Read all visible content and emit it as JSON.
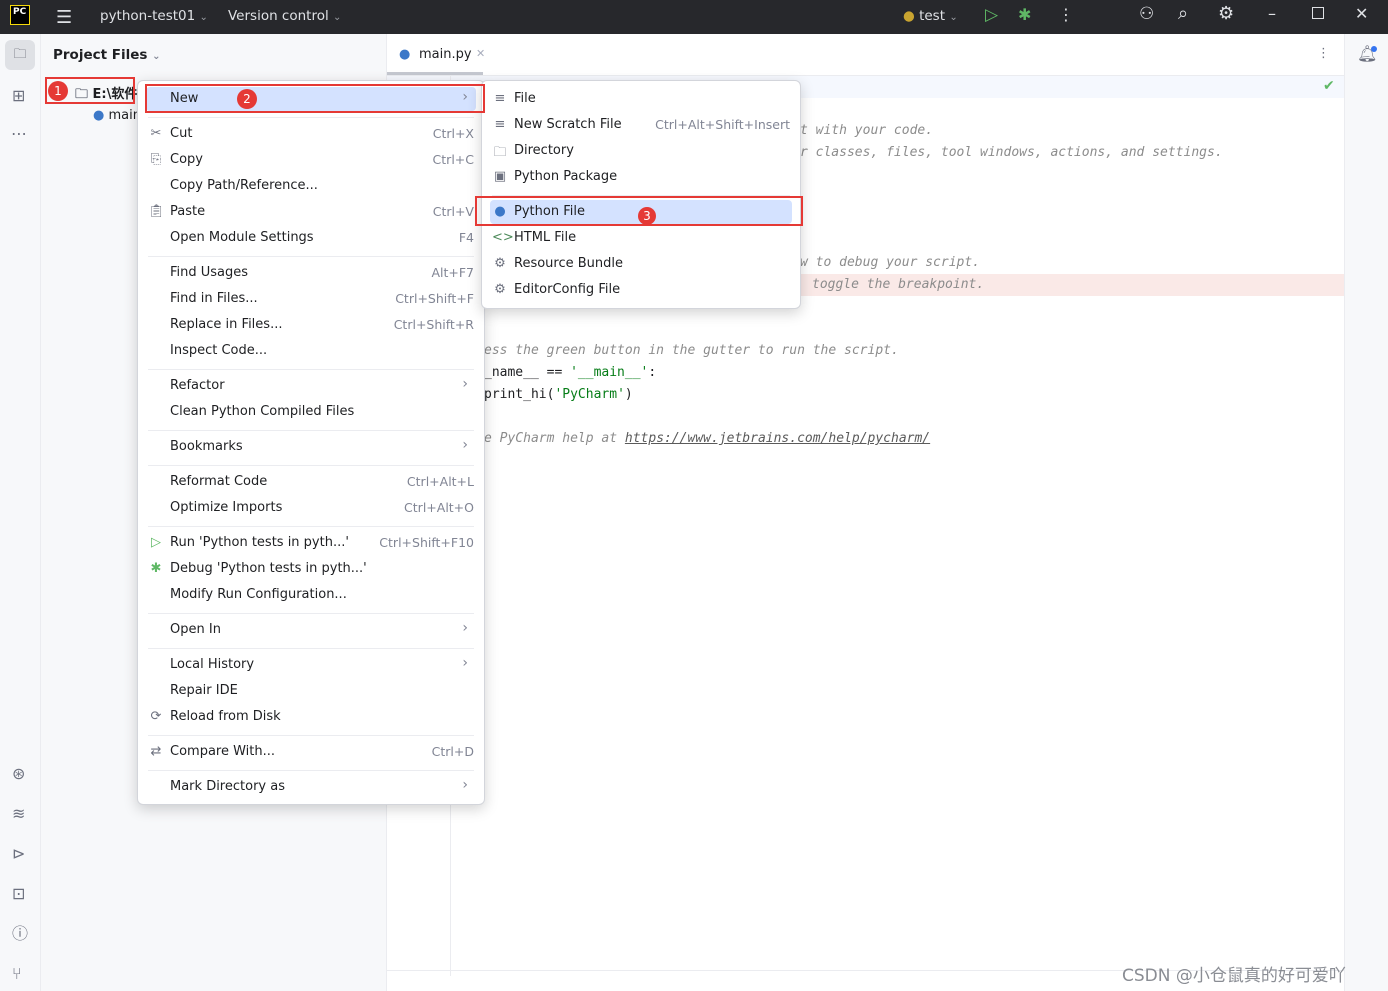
{
  "topbar": {
    "logo": "PC",
    "project": "python-test01",
    "vcs": "Version control",
    "run_config": "test"
  },
  "project_panel": {
    "title": "Project Files",
    "root": "E:\\软件",
    "child": "main"
  },
  "editor": {
    "tab": "main.py",
    "lines": [
      {
        "text": "t with your code.",
        "kind": "comment"
      },
      {
        "text": "r classes, files, tool windows, actions, and settings.",
        "kind": "comment"
      },
      {
        "text": "w to debug your script.",
        "kind": "comment"
      },
      {
        "text": "toggle the breakpoint.",
        "kind": "comment"
      },
      {
        "text": "ess the green button in the gutter to run the script.",
        "kind": "comment"
      },
      {
        "text": "_name__ == ",
        "kind": "code",
        "str": "'__main__'",
        "tail": ":"
      },
      {
        "text": "print_hi(",
        "kind": "code",
        "str": "'PyCharm'",
        "tail": ")"
      },
      {
        "text": "e PyCharm help at ",
        "kind": "comment",
        "link": "https://www.jetbrains.com/help/pycharm/"
      }
    ]
  },
  "context_menu": [
    {
      "label": "New",
      "submenu": true,
      "selected": true
    },
    {
      "sep": true
    },
    {
      "label": "Cut",
      "shortcut": "Ctrl+X",
      "icon": "scissors"
    },
    {
      "label": "Copy",
      "shortcut": "Ctrl+C",
      "icon": "copy"
    },
    {
      "label": "Copy Path/Reference..."
    },
    {
      "label": "Paste",
      "shortcut": "Ctrl+V",
      "icon": "paste"
    },
    {
      "label": "Open Module Settings",
      "shortcut": "F4"
    },
    {
      "sep": true
    },
    {
      "label": "Find Usages",
      "shortcut": "Alt+F7"
    },
    {
      "label": "Find in Files...",
      "shortcut": "Ctrl+Shift+F"
    },
    {
      "label": "Replace in Files...",
      "shortcut": "Ctrl+Shift+R"
    },
    {
      "label": "Inspect Code..."
    },
    {
      "sep": true
    },
    {
      "label": "Refactor",
      "submenu": true
    },
    {
      "label": "Clean Python Compiled Files"
    },
    {
      "sep": true
    },
    {
      "label": "Bookmarks",
      "submenu": true
    },
    {
      "sep": true
    },
    {
      "label": "Reformat Code",
      "shortcut": "Ctrl+Alt+L"
    },
    {
      "label": "Optimize Imports",
      "shortcut": "Ctrl+Alt+O"
    },
    {
      "sep": true
    },
    {
      "label": "Run 'Python tests in pyth...'",
      "shortcut": "Ctrl+Shift+F10",
      "icon": "run"
    },
    {
      "label": "Debug 'Python tests in pyth...'",
      "icon": "debug"
    },
    {
      "label": "Modify Run Configuration..."
    },
    {
      "sep": true
    },
    {
      "label": "Open In",
      "submenu": true
    },
    {
      "sep": true
    },
    {
      "label": "Local History",
      "submenu": true
    },
    {
      "label": "Repair IDE"
    },
    {
      "label": "Reload from Disk",
      "icon": "reload"
    },
    {
      "sep": true
    },
    {
      "label": "Compare With...",
      "shortcut": "Ctrl+D",
      "icon": "compare"
    },
    {
      "sep": true
    },
    {
      "label": "Mark Directory as",
      "submenu": true
    }
  ],
  "submenu": [
    {
      "label": "File",
      "icon": "file"
    },
    {
      "label": "New Scratch File",
      "shortcut": "Ctrl+Alt+Shift+Insert",
      "icon": "scratch"
    },
    {
      "label": "Directory",
      "icon": "folder"
    },
    {
      "label": "Python Package",
      "icon": "package"
    },
    {
      "sep": true
    },
    {
      "label": "Python File",
      "icon": "python",
      "selected": true
    },
    {
      "label": "HTML File",
      "icon": "html"
    },
    {
      "label": "Resource Bundle",
      "icon": "gear"
    },
    {
      "label": "EditorConfig File",
      "icon": "gear"
    }
  ],
  "annotations": {
    "b1": "1",
    "b2": "2",
    "b3": "3"
  },
  "watermark": "CSDN @小仓鼠真的好可爱吖",
  "colors": {
    "accent": "#d4e2ff",
    "annotation": "#e53935",
    "run": "#5fb865"
  }
}
